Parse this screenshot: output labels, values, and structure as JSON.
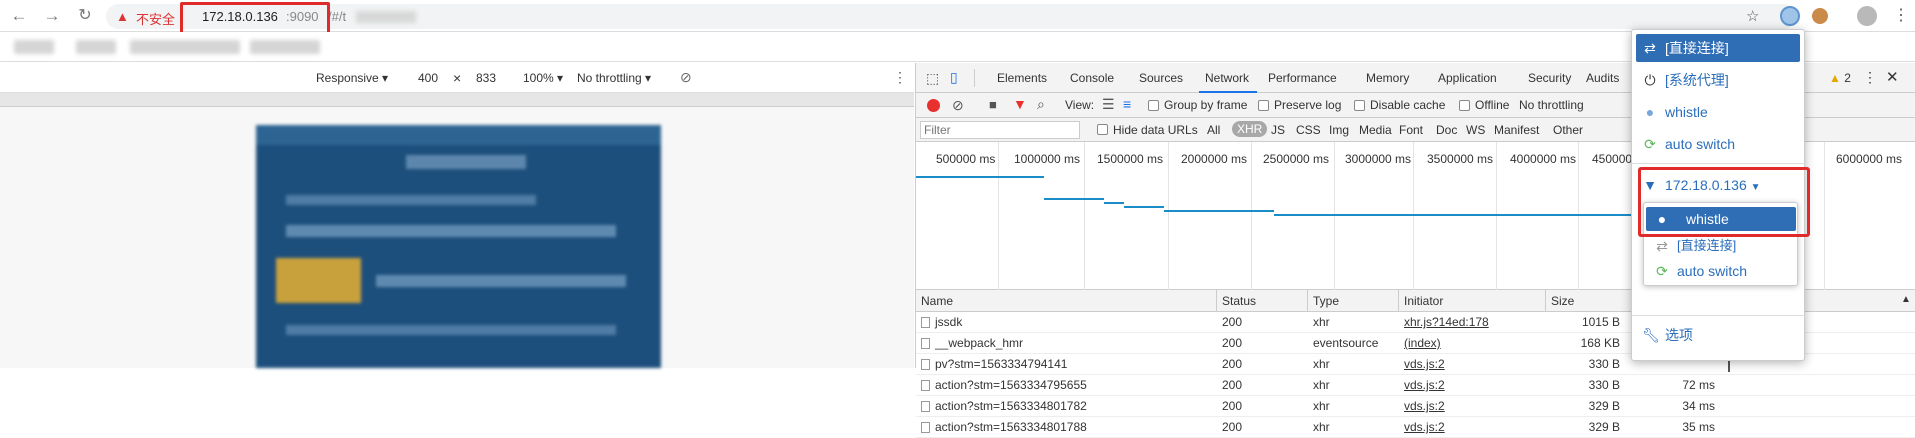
{
  "browser": {
    "insecure_label": "不安全",
    "url_host": "172.18.0.136",
    "url_port": ":9090",
    "url_path": "/#/t"
  },
  "emulation": {
    "device": "Responsive",
    "width": "400",
    "times": "×",
    "height": "833",
    "zoom": "100%",
    "throttling": "No throttling"
  },
  "devtools": {
    "tabs": [
      "Elements",
      "Console",
      "Sources",
      "Network",
      "Performance",
      "Memory",
      "Application",
      "Security",
      "Audits"
    ],
    "active_tab": "Network",
    "warning_count": "2",
    "toolbar": {
      "view_label": "View:",
      "group_by_frame": "Group by frame",
      "preserve_log": "Preserve log",
      "disable_cache": "Disable cache",
      "offline": "Offline",
      "throttling": "No throttling"
    },
    "filter": {
      "placeholder": "Filter",
      "hide_data_urls": "Hide data URLs",
      "types": [
        "All",
        "XHR",
        "JS",
        "CSS",
        "Img",
        "Media",
        "Font",
        "Doc",
        "WS",
        "Manifest",
        "Other"
      ],
      "active_type": "XHR"
    },
    "overview_ticks": [
      "500000 ms",
      "1000000 ms",
      "1500000 ms",
      "2000000 ms",
      "2500000 ms",
      "3000000 ms",
      "3500000 ms",
      "4000000 ms",
      "4500000",
      "6000000 ms"
    ],
    "columns": [
      "Name",
      "Status",
      "Type",
      "Initiator",
      "Size"
    ],
    "rows": [
      {
        "name": "jssdk",
        "status": "200",
        "type": "xhr",
        "initiator": "xhr.js?14ed:178",
        "size": "1015 B",
        "time": ""
      },
      {
        "name": "__webpack_hmr",
        "status": "200",
        "type": "eventsource",
        "initiator": "(index)",
        "size": "168 KB",
        "time": ""
      },
      {
        "name": "pv?stm=1563334794141",
        "status": "200",
        "type": "xhr",
        "initiator": "vds.js:2",
        "size": "330 B",
        "time": ""
      },
      {
        "name": "action?stm=1563334795655",
        "status": "200",
        "type": "xhr",
        "initiator": "vds.js:2",
        "size": "330 B",
        "time": "72 ms"
      },
      {
        "name": "action?stm=1563334801782",
        "status": "200",
        "type": "xhr",
        "initiator": "vds.js:2",
        "size": "329 B",
        "time": "34 ms"
      },
      {
        "name": "action?stm=1563334801788",
        "status": "200",
        "type": "xhr",
        "initiator": "vds.js:2",
        "size": "329 B",
        "time": "35 ms"
      }
    ]
  },
  "proxy_popup": {
    "direct": "[直接连接]",
    "system": "[系统代理]",
    "whistle": "whistle",
    "auto_switch": "auto switch",
    "rule_host": "172.18.0.136",
    "sub_whistle": "whistle",
    "sub_direct": "[直接连接]",
    "sub_auto": "auto switch",
    "options": "选项"
  },
  "colors": {
    "accent": "#1a73e8",
    "popup_blue": "#2a6ebb",
    "highlight_red": "#e02b2b",
    "selected_bg": "#2f6db5"
  }
}
